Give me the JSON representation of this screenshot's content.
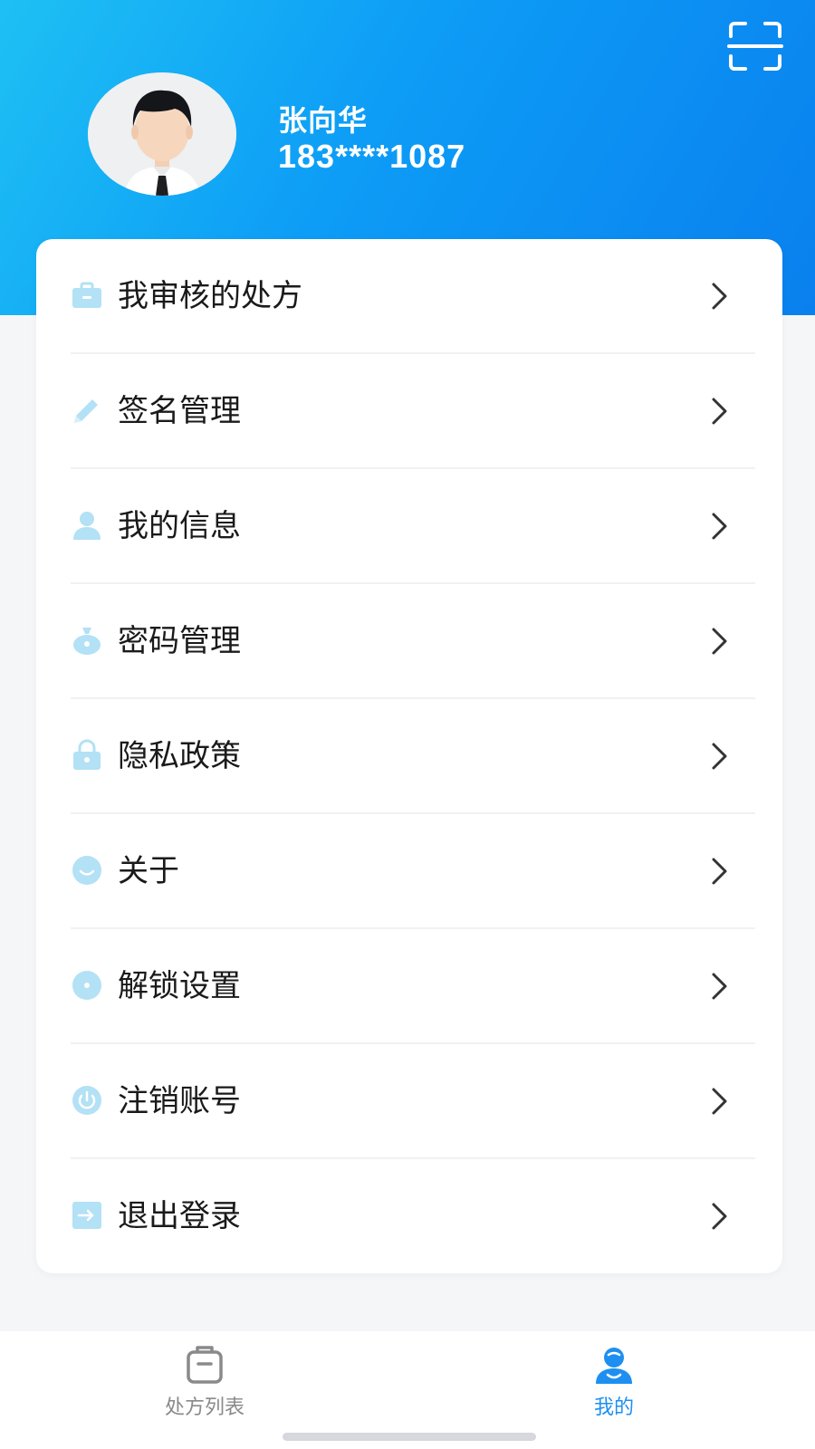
{
  "profile": {
    "name": "张向华",
    "phone": "183****1087"
  },
  "header": {
    "scan_icon": "scan-icon"
  },
  "menu": {
    "items": [
      {
        "label": "我审核的处方",
        "icon": "briefcase-icon"
      },
      {
        "label": "签名管理",
        "icon": "pencil-icon"
      },
      {
        "label": "我的信息",
        "icon": "user-icon"
      },
      {
        "label": "密码管理",
        "icon": "password-bag-icon"
      },
      {
        "label": "隐私政策",
        "icon": "lock-icon"
      },
      {
        "label": "关于",
        "icon": "smile-icon"
      },
      {
        "label": "解锁设置",
        "icon": "unlock-icon"
      },
      {
        "label": "注销账号",
        "icon": "power-icon"
      },
      {
        "label": "退出登录",
        "icon": "logout-icon"
      }
    ]
  },
  "tabbar": {
    "tabs": [
      {
        "label": "处方列表",
        "icon": "clipboard-icon",
        "active": false
      },
      {
        "label": "我的",
        "icon": "profile-icon",
        "active": true
      }
    ]
  },
  "colors": {
    "header_gradient_start": "#1ec0f4",
    "header_gradient_end": "#0a80ee",
    "icon_light_blue": "#b3e1f5",
    "active_tab": "#1e8ff0",
    "inactive_tab": "#8a8a8a"
  }
}
